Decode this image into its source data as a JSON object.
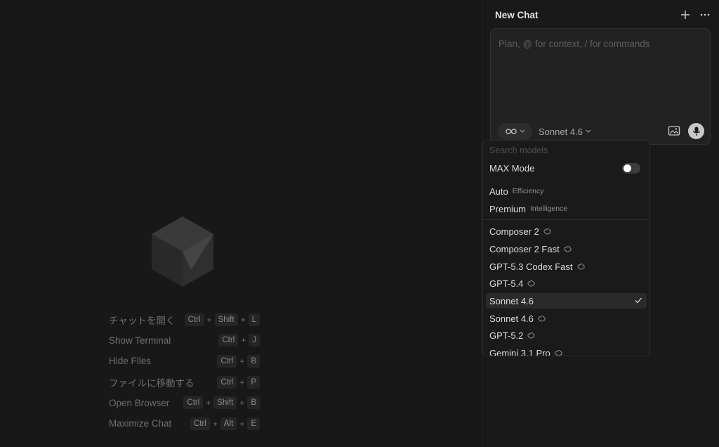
{
  "shortcuts": [
    {
      "label": "チャットを開く",
      "keys": [
        "Ctrl",
        "Shift",
        "L"
      ]
    },
    {
      "label": "Show Terminal",
      "keys": [
        "Ctrl",
        "J"
      ]
    },
    {
      "label": "Hide Files",
      "keys": [
        "Ctrl",
        "B"
      ]
    },
    {
      "label": "ファイルに移動する",
      "keys": [
        "Ctrl",
        "P"
      ]
    },
    {
      "label": "Open Browser",
      "keys": [
        "Ctrl",
        "Shift",
        "B"
      ]
    },
    {
      "label": "Maximize Chat",
      "keys": [
        "Ctrl",
        "Alt",
        "E"
      ]
    }
  ],
  "key_separator": "+",
  "chat": {
    "title": "New Chat",
    "input_placeholder": "Plan, @ for context, / for commands",
    "mode_icon": "infinity-icon",
    "model_label": "Sonnet 4.6"
  },
  "model_menu": {
    "search_placeholder": "Search models",
    "max_mode_label": "MAX Mode",
    "max_mode_enabled": false,
    "presets": [
      {
        "name": "Auto",
        "subtitle": "Efficiency"
      },
      {
        "name": "Premium",
        "subtitle": "Intelligence"
      }
    ],
    "models": [
      {
        "name": "Composer 2",
        "thinking": true,
        "selected": false
      },
      {
        "name": "Composer 2 Fast",
        "thinking": true,
        "selected": false
      },
      {
        "name": "GPT-5.3 Codex Fast",
        "thinking": true,
        "selected": false
      },
      {
        "name": "GPT-5.4",
        "thinking": true,
        "selected": false
      },
      {
        "name": "Sonnet 4.6",
        "thinking": false,
        "selected": true
      },
      {
        "name": "Sonnet 4.6",
        "thinking": true,
        "selected": false
      },
      {
        "name": "GPT-5.2",
        "thinking": true,
        "selected": false
      },
      {
        "name": "Gemini 3.1 Pro",
        "thinking": true,
        "selected": false
      }
    ]
  },
  "colors": {
    "background": "#181818",
    "panel": "#191919",
    "selected_row": "#2a2a2a",
    "muted_text": "#6f6f6f"
  }
}
